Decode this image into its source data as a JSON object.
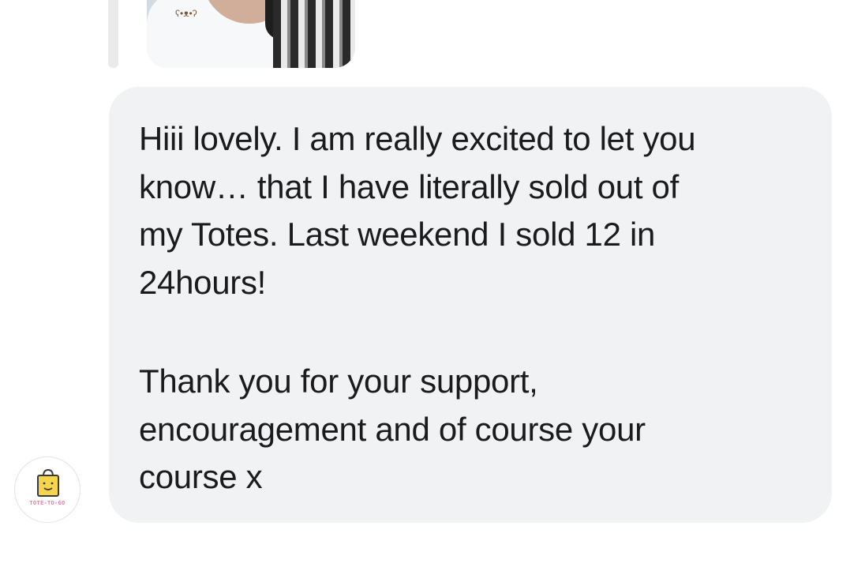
{
  "conversation": {
    "reply_preview": {
      "type": "photo",
      "description_icon": "photo-thumbnail"
    },
    "message": {
      "paragraphs": [
        "Hiii lovely. I am really excited to let you\nknow… that I have literally sold out of\nmy Totes. Last weekend I sold 12 in\n24hours!",
        "Thank you for your support,\nencouragement and of course your\ncourse x"
      ],
      "bubble_color": "#f1f2f4",
      "text_color": "#1b1b1d"
    },
    "sender": {
      "avatar_icon": "tote-bag-logo-icon",
      "avatar_text": "TOTE-TO-GO"
    }
  }
}
